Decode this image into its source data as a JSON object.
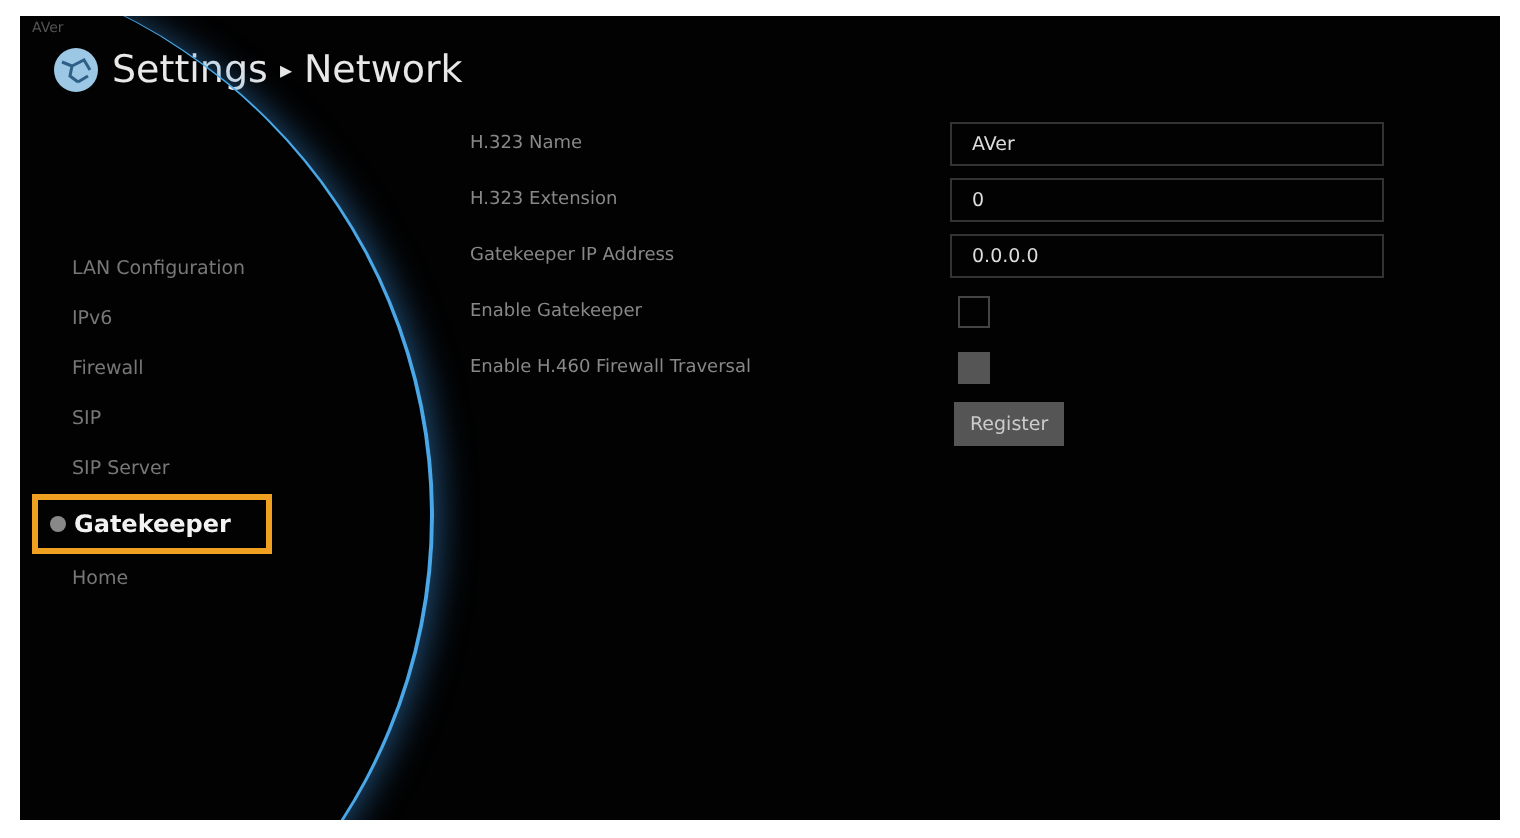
{
  "logo": "AVer",
  "header": {
    "title": "Settings",
    "separator": "▸",
    "subtitle": "Network"
  },
  "sidebar": {
    "items": [
      {
        "label": "LAN Configuration",
        "selected": false
      },
      {
        "label": "IPv6",
        "selected": false
      },
      {
        "label": "Firewall",
        "selected": false
      },
      {
        "label": "SIP",
        "selected": false
      },
      {
        "label": "SIP Server",
        "selected": false
      },
      {
        "label": "Gatekeeper",
        "selected": true
      },
      {
        "label": "Home",
        "selected": false
      }
    ]
  },
  "form": {
    "rows": [
      {
        "kind": "text",
        "label": "H.323 Name",
        "value": "AVer"
      },
      {
        "kind": "text",
        "label": "H.323 Extension",
        "value": "0"
      },
      {
        "kind": "text",
        "label": "Gatekeeper IP Address",
        "value": "0.0.0.0"
      },
      {
        "kind": "checkbox",
        "label": "Enable Gatekeeper",
        "checked": false,
        "disabled": false
      },
      {
        "kind": "checkbox",
        "label": "Enable H.460 Firewall Traversal",
        "checked": false,
        "disabled": true
      }
    ],
    "button": "Register"
  }
}
